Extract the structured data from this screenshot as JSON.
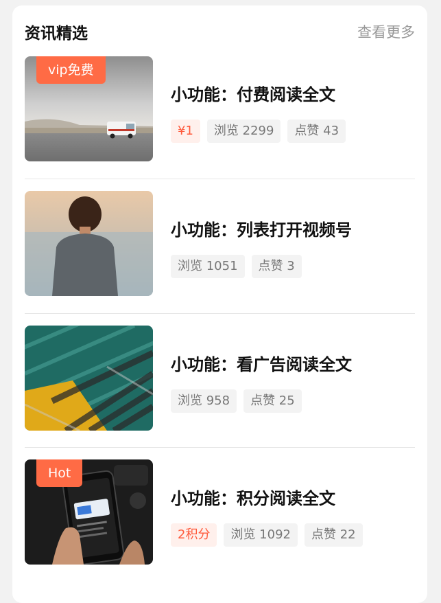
{
  "section": {
    "title": "资讯精选",
    "more_label": "查看更多"
  },
  "articles": [
    {
      "title": "小功能：付费阅读全文",
      "badge": "vip免费",
      "price": "¥1",
      "views": "浏览 2299",
      "likes": "点赞 43",
      "image": "van-on-road-photo"
    },
    {
      "title": "小功能：列表打开视频号",
      "views": "浏览 1051",
      "likes": "点赞 3",
      "image": "person-by-sea-photo"
    },
    {
      "title": "小功能：看广告阅读全文",
      "views": "浏览 958",
      "likes": "点赞 25",
      "image": "striped-fabric-photo"
    },
    {
      "title": "小功能：积分阅读全文",
      "badge": "Hot",
      "price": "2积分",
      "views": "浏览 1092",
      "likes": "点赞 22",
      "image": "phone-in-hand-photo"
    }
  ],
  "colors": {
    "badge": "#ff6b45",
    "price_text": "#ff5a3c",
    "price_bg": "#fff0ec",
    "tag_bg": "#f3f3f3"
  }
}
